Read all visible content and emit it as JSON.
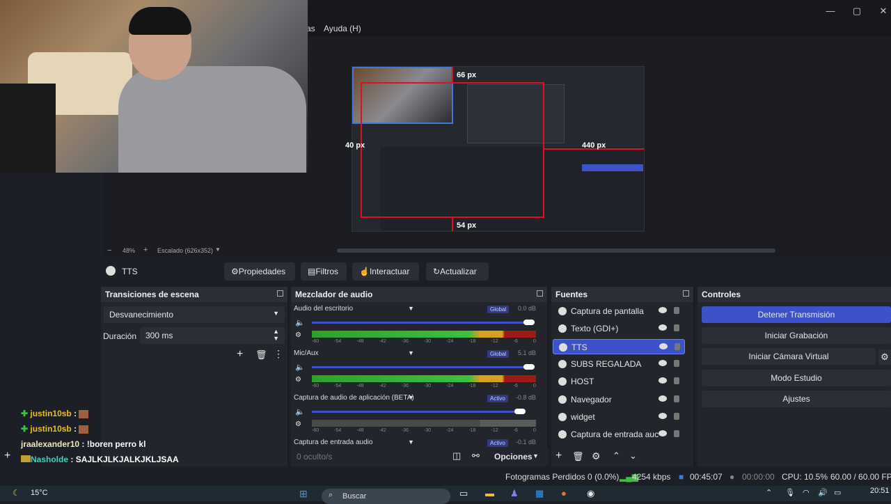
{
  "menu": {
    "partial_item": "as",
    "help": "Ayuda (H)"
  },
  "preview": {
    "measure_top": "66 px",
    "measure_left": "40 px",
    "measure_right": "440 px",
    "measure_bottom": "54 px",
    "zoom_minus": "−",
    "zoom_level": "48%",
    "zoom_plus": "+",
    "scale_label": "Escalado (626x352)"
  },
  "source_toolbar": {
    "current_source": "TTS",
    "properties": "Propiedades",
    "filters": "Filtros",
    "interact": "Interactuar",
    "refresh": "Actualizar"
  },
  "transitions": {
    "title": "Transiciones de escena",
    "selected": "Desvanecimiento",
    "duration_label": "Duración",
    "duration_value": "300 ms"
  },
  "mixer": {
    "title": "Mezclador de audio",
    "scale": [
      "-60",
      "-54",
      "-48",
      "-42",
      "-36",
      "-30",
      "-24",
      "-18",
      "-12",
      "-6",
      "0"
    ],
    "channels": [
      {
        "name": "Audio del escritorio",
        "badge": "Global",
        "db": "0.0 dB",
        "level": 0.97
      },
      {
        "name": "Mic/Aux",
        "badge": "Global",
        "db": "5.1 dB",
        "level": 0.97
      },
      {
        "name": "Captura de audio de aplicación (BETA)",
        "badge": "Activo",
        "db": "-0.8 dB",
        "level": 0.93
      },
      {
        "name": "Captura de entrada audio",
        "badge": "Activo",
        "db": "-0.1 dB",
        "level": 0.97
      }
    ],
    "hidden_count": "0 oculto/s",
    "options": "Opciones"
  },
  "sources": {
    "title": "Fuentes",
    "items": [
      {
        "label": "Captura de pantalla",
        "icon": "monitor-icon"
      },
      {
        "label": "Texto (GDI+)",
        "icon": "text-icon"
      },
      {
        "label": "TTS",
        "icon": "globe-icon",
        "selected": true
      },
      {
        "label": "SUBS REGALADA",
        "icon": "globe-icon"
      },
      {
        "label": "HOST",
        "icon": "globe-icon"
      },
      {
        "label": "Navegador",
        "icon": "globe-icon"
      },
      {
        "label": "widget",
        "icon": "globe-icon"
      },
      {
        "label": "Captura de entrada auc",
        "icon": "mic-icon"
      }
    ]
  },
  "controls": {
    "title": "Controles",
    "stop_stream": "Detener Transmisión",
    "start_recording": "Iniciar Grabación",
    "start_virtual_cam": "Iniciar Cámara Virtual",
    "studio_mode": "Modo Estudio",
    "settings": "Ajustes"
  },
  "chat": [
    {
      "user": "justin10sb",
      "sep": " :",
      "text": "",
      "color": "#e8c020",
      "plus": true
    },
    {
      "user": "justin10sb",
      "sep": " :",
      "text": "",
      "color": "#e8c020",
      "plus": true
    },
    {
      "user": "jraalexander10",
      "sep": " :",
      "text": " !boren perro kl",
      "color": "#f0e8c0",
      "plus": false
    },
    {
      "user": "Nasholde",
      "sep": " :",
      "text": " SAJLKJLKJALKJKLJSAA",
      "color": "#40d0c0",
      "plus": false
    }
  ],
  "status": {
    "dropped_frames": "Fotogramas Perdidos 0 (0.0%)",
    "bitrate": "4254 kbps",
    "stream_time": "00:45:07",
    "rec_time": "00:00:00",
    "cpu": "CPU: 10.5%",
    "fps": "60.00 / 60.00 FPS"
  },
  "taskbar": {
    "weather": "15°C",
    "search": "Buscar",
    "time": "20:51"
  },
  "colors": {
    "accent": "#3d52c9",
    "dock_bg": "#22252c",
    "measure_red": "#e01020"
  }
}
